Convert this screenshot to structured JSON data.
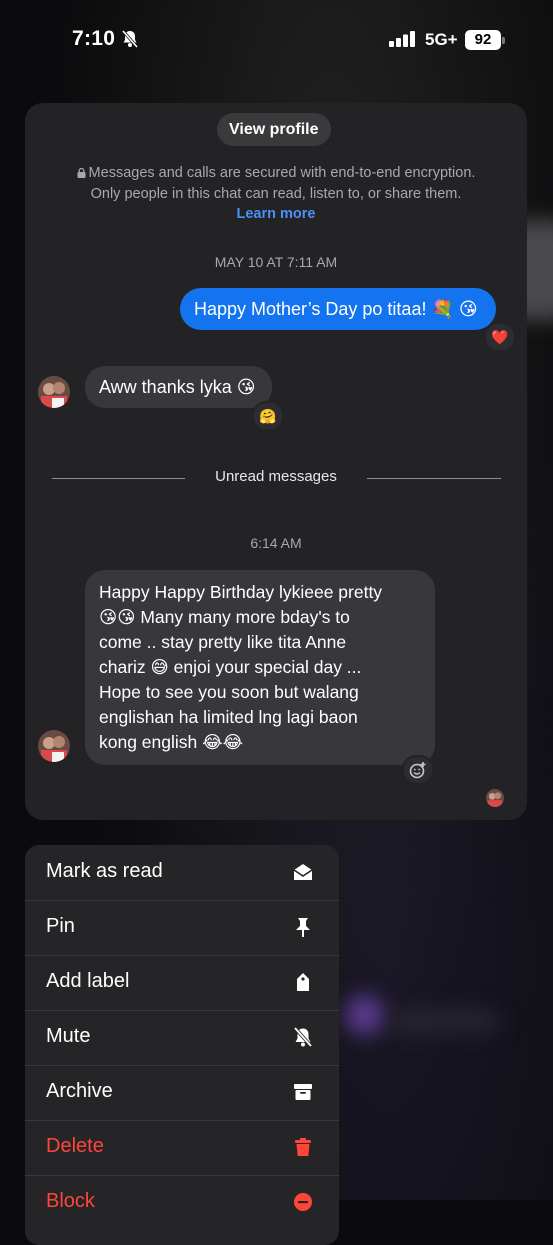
{
  "status_bar": {
    "time": "7:10",
    "network": "5G+",
    "battery": "92"
  },
  "chat": {
    "view_profile": "View profile",
    "encryption_line1": "Messages and calls are secured with end-to-end encryption.",
    "encryption_line2": "Only people in this chat can read, listen to, or share them.",
    "learn_more": "Learn more",
    "timestamp_1": "MAY 10 AT 7:11 AM",
    "outgoing_message": "Happy Mother’s Day po titaa! 💐 😘",
    "outgoing_reaction": "❤️",
    "incoming_message_1": "Aww thanks lyka 😘",
    "incoming_reaction_1": "🤗",
    "unread_label": "Unread messages",
    "timestamp_2": "6:14 AM",
    "incoming_message_2_lines": [
      "Happy Happy Birthday lykieee pretty",
      "😘😘 Many many more bday's to",
      "come .. stay pretty like tita Anne",
      "chariz 😅 enjoi your special day ...",
      "Hope to see you soon but walang",
      "englishan ha limited lng lagi baon",
      "kong english 😂😂"
    ]
  },
  "menu": {
    "items": [
      {
        "label": "Mark as read",
        "icon": "envelope-open-icon"
      },
      {
        "label": "Pin",
        "icon": "pin-icon"
      },
      {
        "label": "Add label",
        "icon": "tag-icon"
      },
      {
        "label": "Mute",
        "icon": "bell-slash-icon"
      },
      {
        "label": "Archive",
        "icon": "archive-box-icon"
      },
      {
        "label": "Delete",
        "icon": "trash-icon"
      },
      {
        "label": "Block",
        "icon": "block-icon"
      }
    ]
  },
  "colors": {
    "accent": "#1473ef",
    "danger": "#ff453a",
    "link": "#4b8ff7"
  }
}
